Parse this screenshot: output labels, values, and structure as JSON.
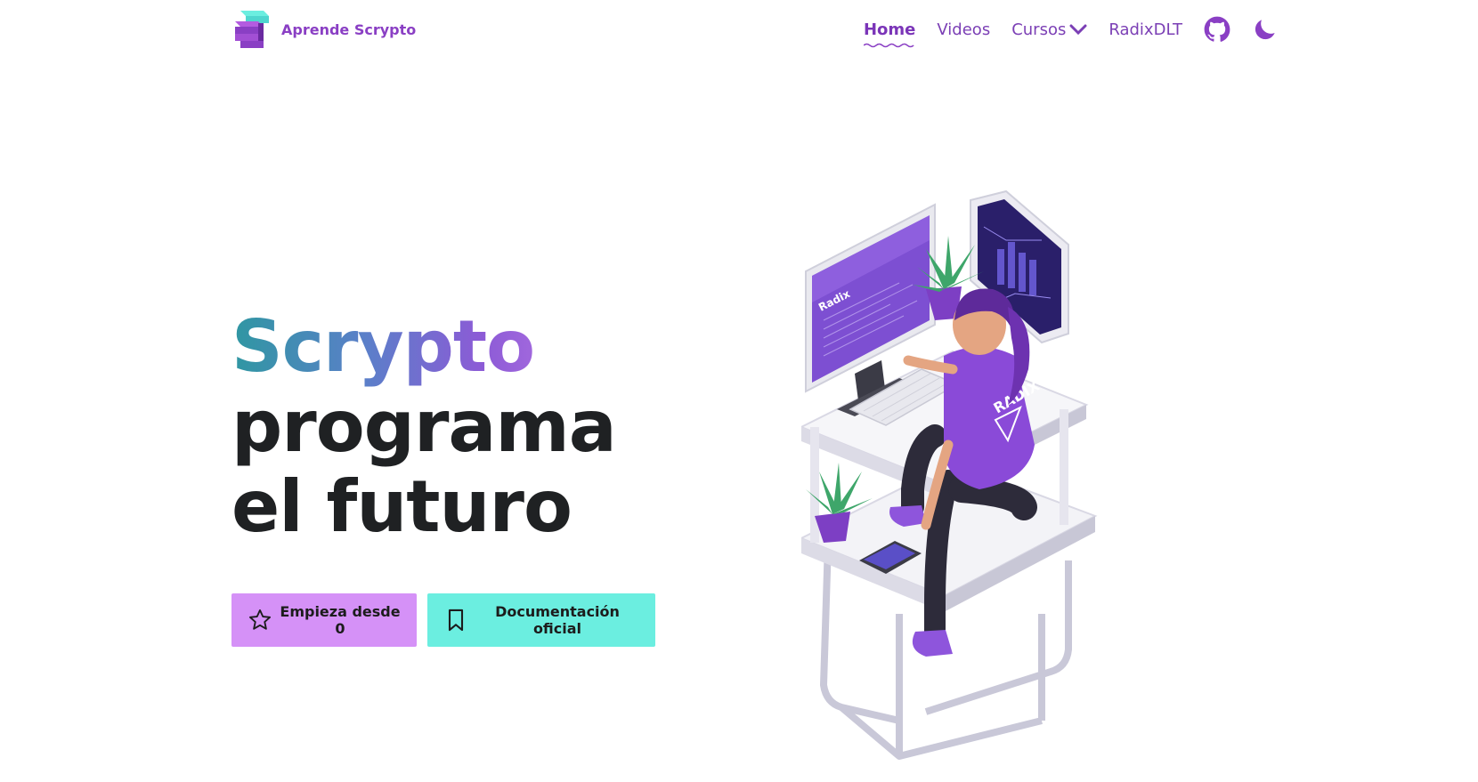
{
  "brand": {
    "name": "Aprende Scrypto",
    "logo_icon": "scrypto-logo-icon"
  },
  "nav": {
    "items": [
      {
        "label": "Home",
        "active": true
      },
      {
        "label": "Videos",
        "active": false
      },
      {
        "label": "Cursos",
        "active": false,
        "has_dropdown": true
      },
      {
        "label": "RadixDLT",
        "active": false
      }
    ],
    "icons": [
      "github-icon",
      "moon-icon"
    ]
  },
  "hero": {
    "title_brand": "Scrypto",
    "title_line1": "programa",
    "title_line2": "el futuro",
    "primary_button": "Empieza desde 0",
    "secondary_button": "Documentación oficial"
  },
  "illustration": {
    "shirt_text": "RADIX",
    "monitor_text": "Radix"
  },
  "colors": {
    "brand": "#8a3fc4",
    "primary_button": "#d591f7",
    "secondary_button": "#6beee0",
    "gradient": [
      "#2f97a2",
      "#5b7fc9",
      "#8c5bd6",
      "#c07ae8"
    ]
  }
}
